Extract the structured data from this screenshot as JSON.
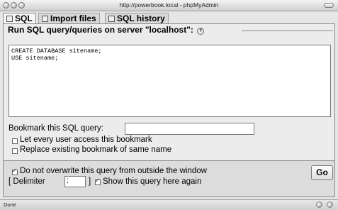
{
  "window": {
    "title": "http://powerbook.local - phpMyAdmin"
  },
  "tabs": [
    {
      "label": "SQL",
      "icon": "sql-icon"
    },
    {
      "label": "Import files",
      "icon": "import-icon"
    },
    {
      "label": "SQL history",
      "icon": "history-icon"
    }
  ],
  "query_panel": {
    "legend": "Run SQL query/queries on server \"localhost\":",
    "sql_text": "CREATE DATABASE sitename;\nUSE sitename;",
    "bookmark_label": "Bookmark this SQL query:",
    "bookmark_value": "",
    "let_every_user_label": "Let every user access this bookmark",
    "replace_label": "Replace existing bookmark of same name"
  },
  "options": {
    "no_overwrite_label": "Do not overwrite this query from outside the window",
    "delimiter_label_start": "[ Delimiter",
    "delimiter_value": ";",
    "delimiter_label_end": "]",
    "show_again_label": "Show this query here again",
    "go_label": "Go"
  },
  "status": {
    "text": "Done"
  }
}
